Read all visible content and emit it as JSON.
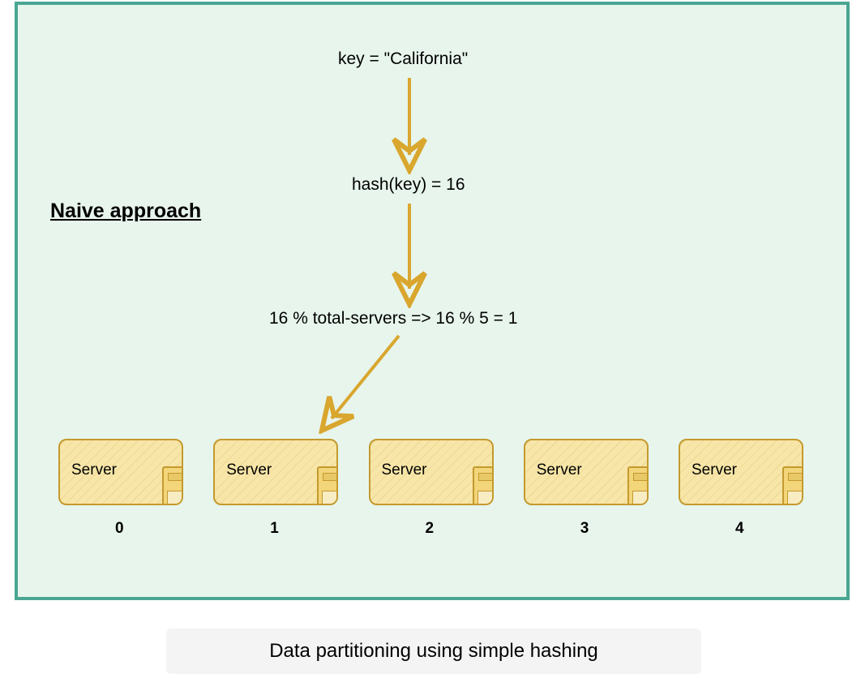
{
  "title_side": "Naive approach",
  "steps": {
    "key_line": "key = \"California\"",
    "hash_line": "hash(key) = 16",
    "mod_line": "16 % total-servers => 16 % 5 = 1"
  },
  "servers": [
    {
      "label": "Server",
      "index": "0"
    },
    {
      "label": "Server",
      "index": "1"
    },
    {
      "label": "Server",
      "index": "2"
    },
    {
      "label": "Server",
      "index": "3"
    },
    {
      "label": "Server",
      "index": "4"
    }
  ],
  "caption": "Data partitioning using simple hashing",
  "colors": {
    "frame_border": "#4aa693",
    "frame_bg": "#e7f5ec",
    "arrow": "#d9a62e",
    "server_fill": "#f7e6a8",
    "server_border": "#c49a2e"
  }
}
